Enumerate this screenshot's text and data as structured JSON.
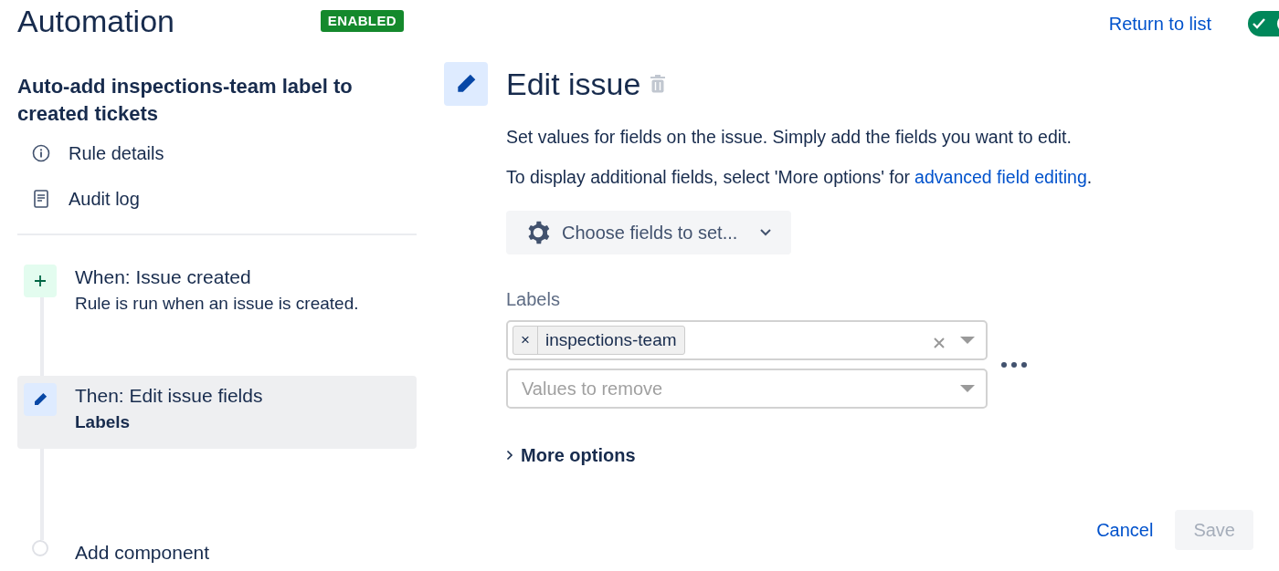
{
  "header": {
    "title": "Automation",
    "status_badge": "ENABLED",
    "return_link": "Return to list",
    "toggle": {
      "on": true
    }
  },
  "rule": {
    "title": "Auto-add inspections-team label to created tickets",
    "nav": [
      {
        "kind": "info",
        "label": "Rule details"
      },
      {
        "kind": "log",
        "label": "Audit log"
      }
    ]
  },
  "steps": [
    {
      "kind": "trigger",
      "title": "When: Issue created",
      "description": "Rule is run when an issue is created.",
      "selected": false
    },
    {
      "kind": "action",
      "title": "Then: Edit issue fields",
      "detail": "Labels",
      "selected": true
    },
    {
      "kind": "add",
      "title": "Add component",
      "selected": false
    }
  ],
  "editor": {
    "title": "Edit issue",
    "description": "Set values for fields on the issue. Simply add the fields you want to edit.",
    "advanced_prefix": "To display additional fields, select 'More options' for ",
    "advanced_link": "advanced field editing",
    "advanced_suffix": ".",
    "choose_button": "Choose fields to set...",
    "labels": {
      "label": "Labels",
      "remove_icon": "×",
      "tags": [
        "inspections-team"
      ],
      "remove_placeholder": "Values to remove"
    },
    "more_options": {
      "label": "More options",
      "expanded": false
    },
    "cancel": "Cancel",
    "save": {
      "label": "Save",
      "disabled": true
    }
  }
}
